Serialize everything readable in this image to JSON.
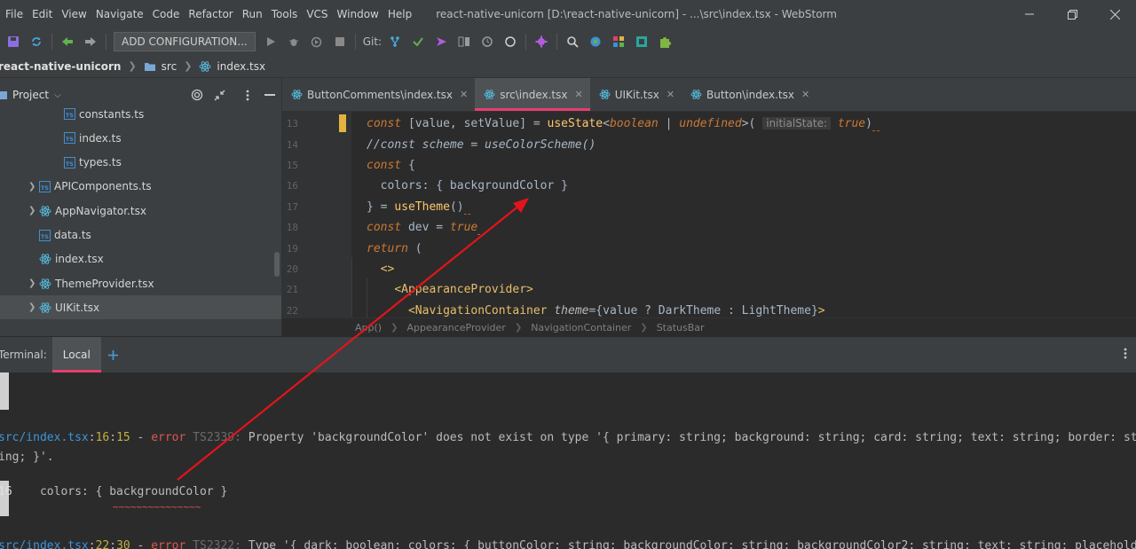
{
  "menu": {
    "items": [
      "File",
      "Edit",
      "View",
      "Navigate",
      "Code",
      "Refactor",
      "Run",
      "Tools",
      "VCS",
      "Window",
      "Help"
    ],
    "window_title": "react-native-unicorn [D:\\react-native-unicorn] - ...\\src\\index.tsx - WebStorm"
  },
  "toolbar": {
    "config_label": "ADD CONFIGURATION...",
    "git_label": "Git:"
  },
  "breadcrumb": {
    "project": "react-native-unicorn",
    "folder": "src",
    "file": "index.tsx"
  },
  "project_panel": {
    "title": "Project",
    "items": [
      {
        "name": "constants.ts",
        "type": "ts",
        "indent": 3,
        "arrow": false
      },
      {
        "name": "index.ts",
        "type": "ts",
        "indent": 3,
        "arrow": false
      },
      {
        "name": "types.ts",
        "type": "ts",
        "indent": 3,
        "arrow": false
      },
      {
        "name": "APIComponents.ts",
        "type": "ts",
        "indent": 2,
        "arrow": true
      },
      {
        "name": "AppNavigator.tsx",
        "type": "react",
        "indent": 2,
        "arrow": true
      },
      {
        "name": "data.ts",
        "type": "ts",
        "indent": 2,
        "arrow": false
      },
      {
        "name": "index.tsx",
        "type": "react",
        "indent": 2,
        "arrow": false
      },
      {
        "name": "ThemeProvider.tsx",
        "type": "react",
        "indent": 2,
        "arrow": true
      },
      {
        "name": "UIKit.tsx",
        "type": "react",
        "indent": 2,
        "arrow": true,
        "selected": true
      }
    ]
  },
  "editor_tabs": [
    {
      "label": "ButtonComments\\index.tsx",
      "active": false
    },
    {
      "label": "src\\index.tsx",
      "active": true
    },
    {
      "label": "UIKit.tsx",
      "active": false
    },
    {
      "label": "Button\\index.tsx",
      "active": false
    }
  ],
  "editor": {
    "line_numbers": [
      "13",
      "14",
      "15",
      "16",
      "17",
      "18",
      "19",
      "20",
      "21",
      "22"
    ],
    "hint_label": "initialState:",
    "crumbs": [
      "App()",
      "AppearanceProvider",
      "NavigationContainer",
      "StatusBar"
    ]
  },
  "terminal": {
    "label": "Terminal:",
    "tab": "Local",
    "error1": {
      "path": "src/index.tsx",
      "line": "16",
      "col": "15",
      "level": "error",
      "code": "TS2339:",
      "message": " Property 'backgroundColor' does not exist on type '{ primary: string; background: string; card: string; text: string; border: str",
      "wrap": "ing; }'."
    },
    "snippet_line": "16",
    "snippet_code": "    colors: { backgroundColor }",
    "underline": "~~~~~~~~~~~~~~~",
    "error2": {
      "path": "src/index.tsx",
      "line": "22",
      "col": "30",
      "level": "error",
      "code": "TS2322:",
      "message": " Type '{ dark: boolean; colors: { buttonColor: string; backgroundColor: string; backgroundColor2: string; text: string; placeholde"
    }
  },
  "colors": {
    "accent": "#e63e6d",
    "annotation_arrow": "#e3141b",
    "error": "#e05656",
    "path": "#3a96dd"
  }
}
